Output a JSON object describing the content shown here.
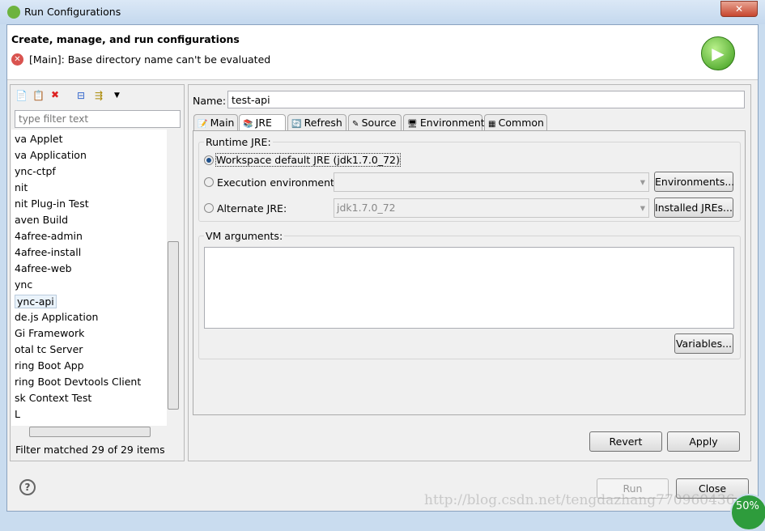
{
  "window": {
    "title": "Run Configurations",
    "close": "✕"
  },
  "header": {
    "title": "Create, manage, and run configurations",
    "error": "[Main]: Base directory name can't be evaluated"
  },
  "left": {
    "filter_placeholder": "type filter text",
    "items": [
      "va Applet",
      "va Application",
      "ync-ctpf",
      "nit",
      "nit Plug-in Test",
      "aven Build",
      "4afree-admin",
      "4afree-install",
      "4afree-web",
      "ync",
      "ync-api",
      "de.js Application",
      "Gi Framework",
      "otal tc Server",
      "ring Boot App",
      "ring Boot Devtools Client",
      "sk Context Test",
      "L"
    ],
    "selected_index": 10,
    "status": "Filter matched 29 of 29 items"
  },
  "right": {
    "name_label": "Name:",
    "name_value": "test-api",
    "tabs": [
      "Main",
      "JRE",
      "Refresh",
      "Source",
      "Environment",
      "Common"
    ],
    "selected_tab": "JRE",
    "runtime_group": "Runtime JRE:",
    "opt_workspace": "Workspace default JRE (jdk1.7.0_72)",
    "opt_exec": "Execution environment:",
    "opt_alt": "Alternate JRE:",
    "exec_value": "",
    "alt_value": "jdk1.7.0_72",
    "environments_btn": "Environments...",
    "installed_btn": "Installed JREs...",
    "vm_group": "VM arguments:",
    "vm_value": "",
    "variables_btn": "Variables...",
    "revert_btn": "Revert",
    "apply_btn": "Apply"
  },
  "footer": {
    "run_btn": "Run",
    "close_btn": "Close",
    "help": "?"
  },
  "overlay": {
    "watermark": "http://blog.csdn.net/tengdazhang770960436",
    "badge": "50%"
  }
}
